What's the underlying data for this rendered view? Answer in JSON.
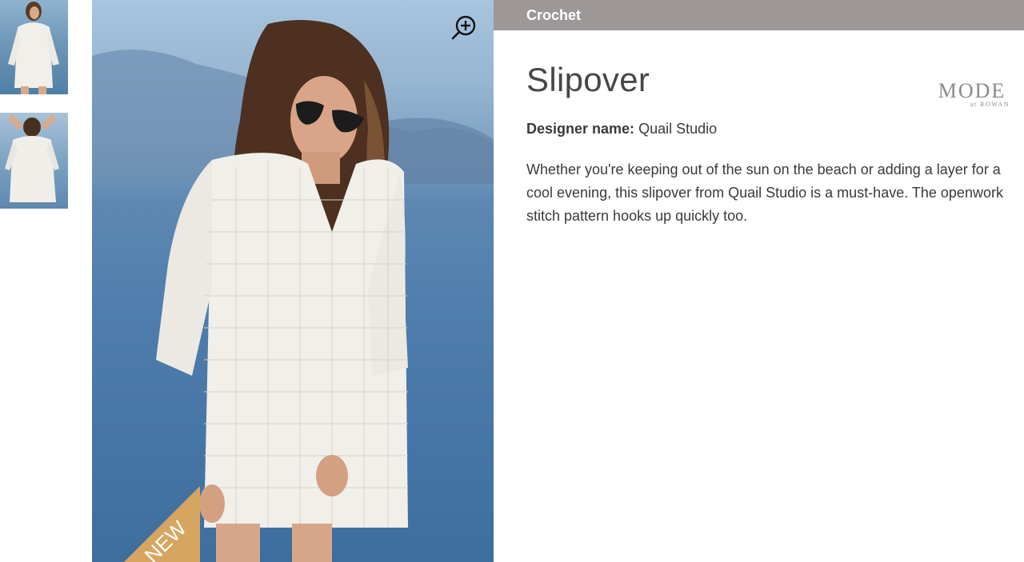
{
  "thumbnails": [
    {
      "name": "Front view"
    },
    {
      "name": "Back view"
    }
  ],
  "category": "Crochet",
  "product": {
    "title": "Slipover",
    "designer_label": "Designer name:",
    "designer_name": "Quail Studio",
    "description": "Whether you're keeping out of the sun on the beach or adding a layer for a cool evening, this slipover from Quail Studio is a must-have. The openwork stitch pattern hooks up quickly too."
  },
  "badge": {
    "text": "NEW",
    "color": "#d6a560"
  },
  "brand": {
    "logo_main": "MODE",
    "logo_sub": "at ROWAN"
  },
  "colors": {
    "category_bar": "#9e9797",
    "title": "#474747"
  },
  "icons": {
    "zoom": "zoom-in-icon"
  }
}
